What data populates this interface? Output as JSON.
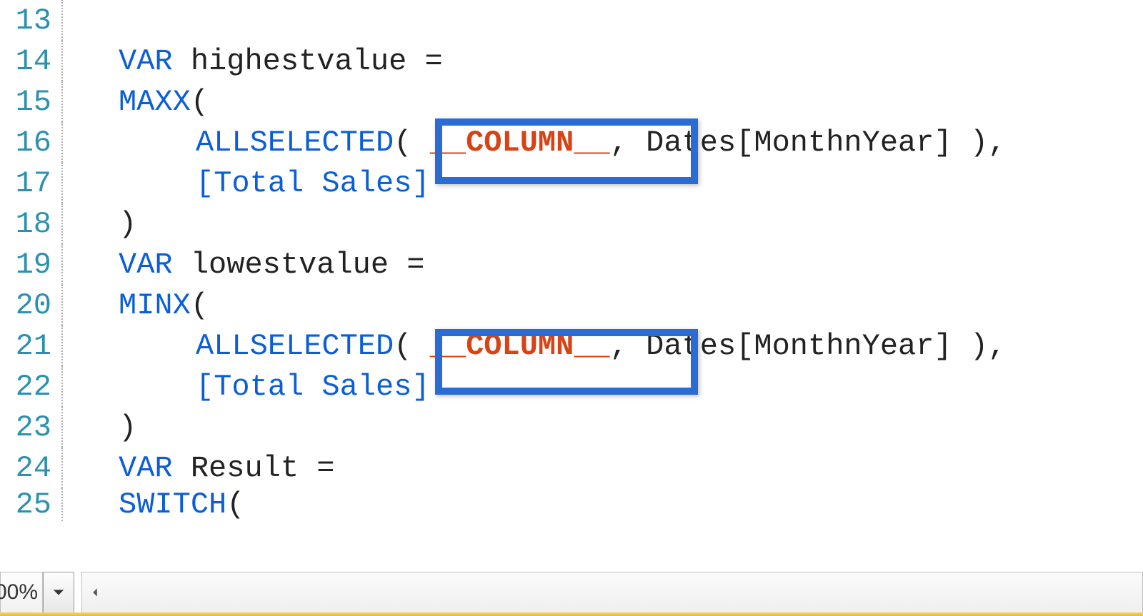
{
  "gutter": {
    "l13": "13",
    "l14": "14",
    "l15": "15",
    "l16": "16",
    "l17": "17",
    "l18": "18",
    "l19": "19",
    "l20": "20",
    "l21": "21",
    "l22": "22",
    "l23": "23",
    "l24": "24",
    "l25": "25"
  },
  "kw": {
    "var": "VAR",
    "maxx": "MAXX",
    "minx": "MINX",
    "allselected": "ALLSELECTED",
    "switch": "SWITCH"
  },
  "ident": {
    "highestvalue": "highestvalue",
    "lowestvalue": "lowestvalue",
    "result": "Result"
  },
  "param": {
    "column": "__COLUMN__"
  },
  "ref": {
    "dates": "Dates",
    "monthnyear": "[MonthnYear]",
    "totalsales": "[Total Sales]"
  },
  "punct": {
    "eq": " =",
    "open": "(",
    "close": ")",
    "comma_sp": ", ",
    "sp_close_comma": " ),",
    "space": " "
  },
  "status": {
    "zoom": "00%"
  }
}
